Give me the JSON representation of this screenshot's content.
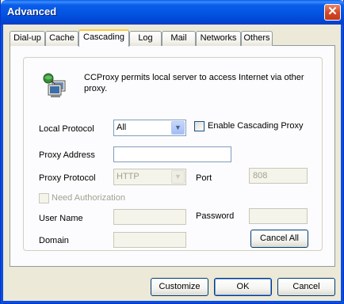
{
  "window": {
    "title": "Advanced",
    "close_glyph": "✕"
  },
  "tabs": [
    {
      "label": "Dial-up"
    },
    {
      "label": "Cache"
    },
    {
      "label": "Cascading"
    },
    {
      "label": "Log"
    },
    {
      "label": "Mail"
    },
    {
      "label": "Networks"
    },
    {
      "label": "Others"
    }
  ],
  "active_tab": "Cascading",
  "panel": {
    "description": "CCProxy permits local server to access Internet via other proxy.",
    "icon": "network-computers-icon",
    "local_protocol": {
      "label": "Local Protocol",
      "value": "All"
    },
    "enable_cascading": {
      "label": "Enable Cascading Proxy",
      "checked": false
    },
    "proxy_address": {
      "label": "Proxy Address",
      "value": ""
    },
    "proxy_protocol": {
      "label": "Proxy Protocol",
      "value": "HTTP"
    },
    "port": {
      "label": "Port",
      "value": "808"
    },
    "need_authorization": {
      "label": "Need Authorization",
      "checked": false
    },
    "user_name": {
      "label": "User Name",
      "value": ""
    },
    "password": {
      "label": "Password",
      "value": ""
    },
    "domain": {
      "label": "Domain",
      "value": ""
    },
    "cancel_all_label": "Cancel All"
  },
  "footer": {
    "customize_label": "Customize",
    "ok_label": "OK",
    "cancel_label": "Cancel"
  },
  "colors": {
    "titlebar": "#0454e2",
    "dialog_bg": "#ece9d8",
    "panel_bg": "#fcfcfe",
    "active_tab_accent": "#ffc83c",
    "close_button": "#d34a2a"
  }
}
